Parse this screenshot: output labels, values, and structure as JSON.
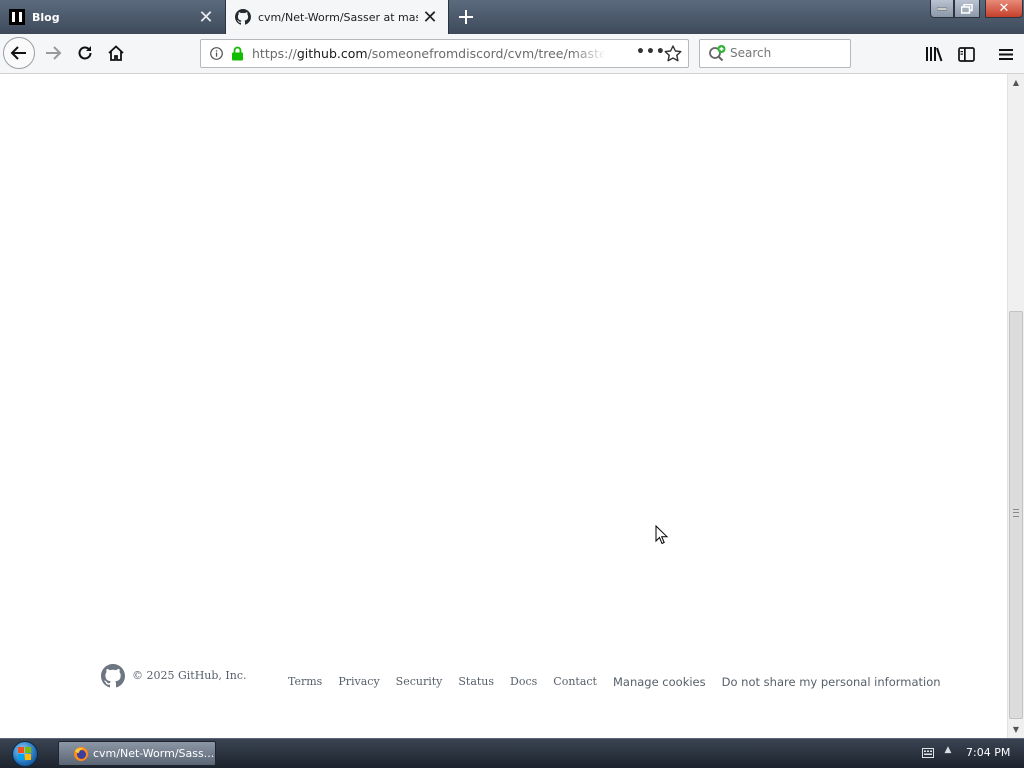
{
  "browser": {
    "tabs": [
      {
        "title": "Blog",
        "active": false
      },
      {
        "title": "cvm/Net-Worm/Sasser at master · someonefromdiscord/cvm",
        "active": true
      }
    ],
    "url": {
      "prefix": "https://",
      "host": "github.com",
      "path": "/someonefromdiscord/cvm/tree/master/Net-Worm/Sasser"
    },
    "search": {
      "placeholder": "Search",
      "value": ""
    }
  },
  "page": {
    "footer": {
      "copyright": "© 2025 GitHub, Inc.",
      "links": [
        "Terms",
        "Privacy",
        "Security",
        "Status",
        "Docs",
        "Contact",
        "Manage cookies",
        "Do not share my personal information"
      ]
    }
  },
  "taskbar": {
    "items": [
      {
        "label": "cvm/Net-Worm/Sass..."
      }
    ],
    "clock": "7:04 PM"
  },
  "colors": {
    "lock_green": "#12bc00",
    "footer_text": "#57606a",
    "tabstrip": "#4a5668"
  }
}
